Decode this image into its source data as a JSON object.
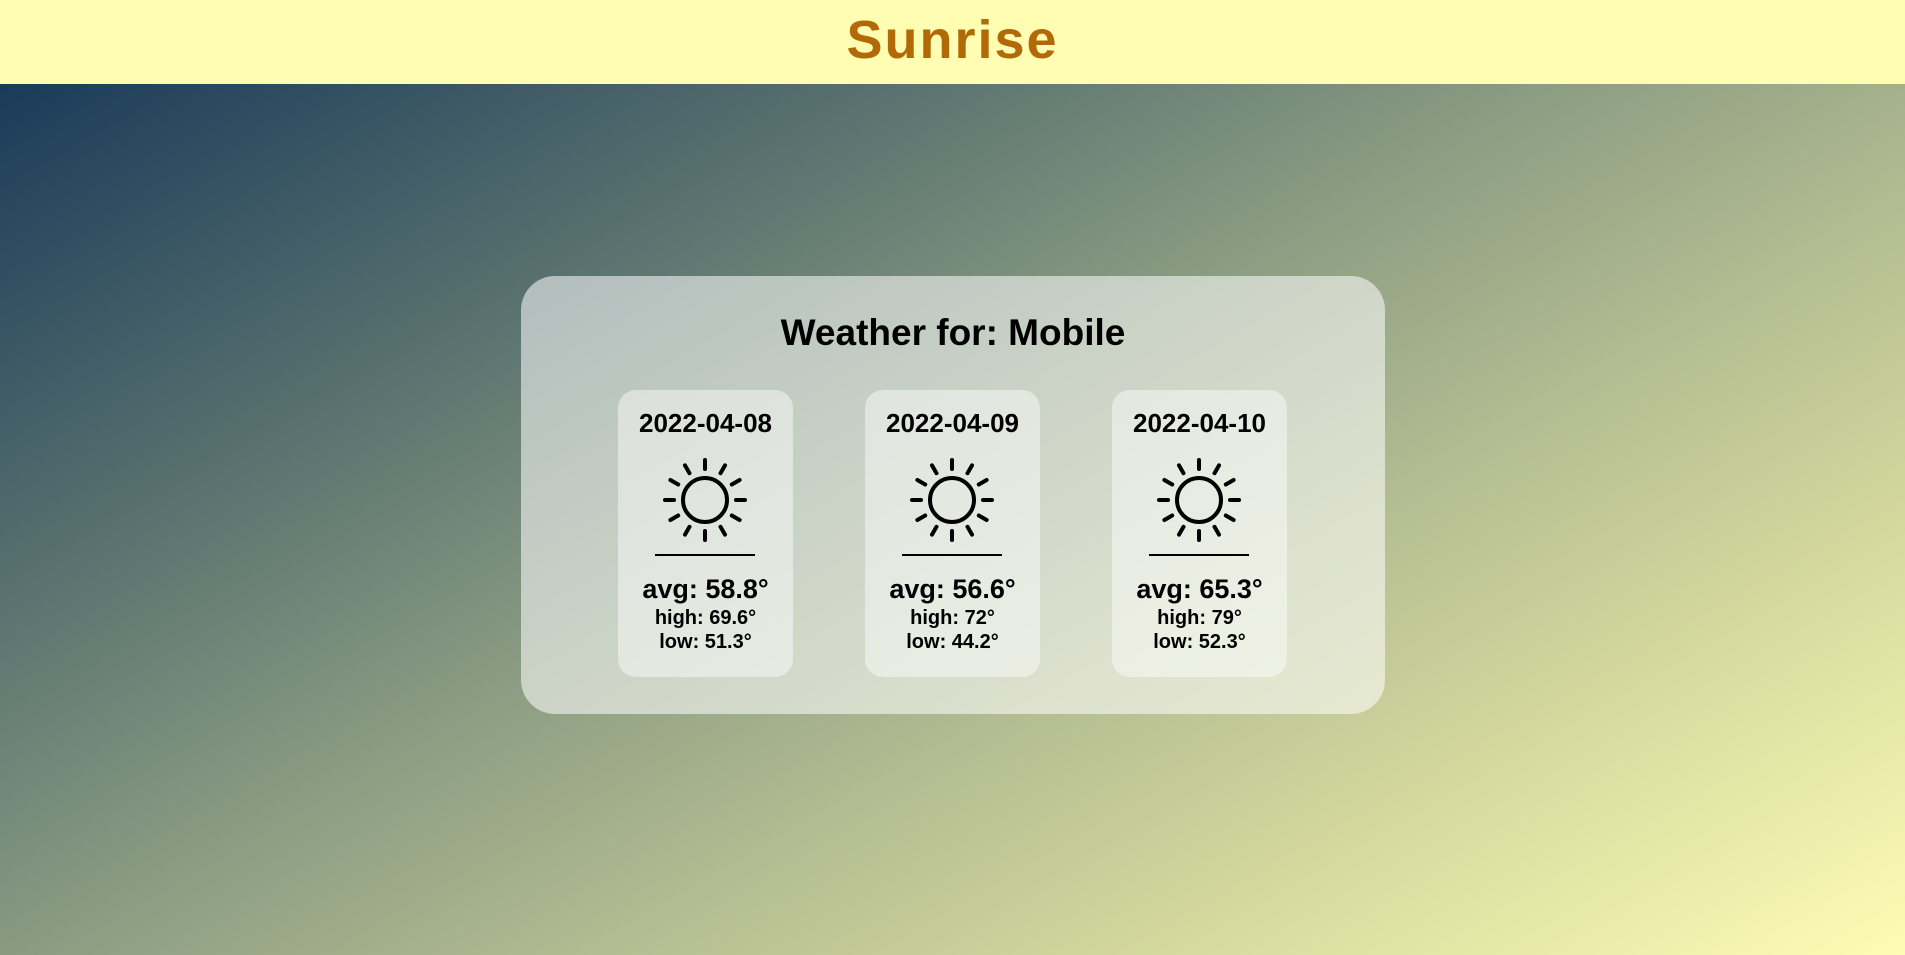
{
  "header": {
    "brand": "Sunrise"
  },
  "panel": {
    "title_prefix": "Weather for:",
    "location": "Mobile",
    "title": "Weather for: Mobile"
  },
  "forecast": [
    {
      "date": "2022-04-08",
      "icon": "sun-icon",
      "avg": "avg: 58.8°",
      "high": "high: 69.6°",
      "low": "low: 51.3°"
    },
    {
      "date": "2022-04-09",
      "icon": "sun-icon",
      "avg": "avg: 56.6°",
      "high": "high: 72°",
      "low": "low: 44.2°"
    },
    {
      "date": "2022-04-10",
      "icon": "sun-icon",
      "avg": "avg: 65.3°",
      "high": "high: 79°",
      "low": "low: 52.3°"
    }
  ],
  "colors": {
    "header_bg": "#fefdb1",
    "brand": "#b26a08",
    "gradient_start": "#1a3a59",
    "gradient_end": "#fefcb6"
  }
}
